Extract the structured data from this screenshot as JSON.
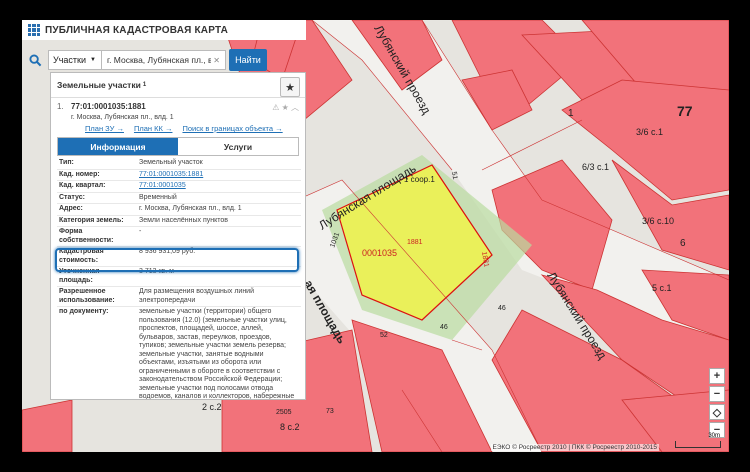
{
  "header": {
    "title": "ПУБЛИЧНАЯ КАДАСТРОВАЯ КАРТА"
  },
  "search": {
    "type_label": "Участки",
    "query": "г. Москва, Лубянская пл., влд. 1",
    "button": "Найти"
  },
  "panel": {
    "title": "Земельные участки",
    "count": "1",
    "item_number": "1.",
    "cadastral_number": "77:01:0001035:1881",
    "address": "г. Москва, Лубянская пл., влд. 1",
    "links": [
      "План ЗУ →",
      "План КК →",
      "Поиск в границах объекта →"
    ],
    "tabs": [
      "Информация",
      "Услуги"
    ],
    "fields": [
      {
        "k": "Тип:",
        "v": "Земельный участок"
      },
      {
        "k": "Кад. номер:",
        "v": "77:01:0001035:1881",
        "link": true
      },
      {
        "k": "Кад. квартал:",
        "v": "77:01:0001035",
        "link": true
      },
      {
        "k": "Статус:",
        "v": "Временный"
      },
      {
        "k": "Адрес:",
        "v": "г. Москва, Лубянская пл., влд. 1"
      },
      {
        "k": "Категория земель:",
        "v": "Земли населённых пунктов"
      },
      {
        "k": "Форма собственности:",
        "v": "-"
      },
      {
        "k": "Кадастровая стоимость:",
        "v": "8 936 931,09 руб."
      },
      {
        "k": "Уточненная площадь:",
        "v": "3 713 кв. м"
      },
      {
        "k": "Разрешенное использование:",
        "v": "Для размещения воздушных линий электропередачи"
      },
      {
        "k": "по документу:",
        "v": "земельные участки (территории) общего пользования (12.0) (земельные участки улиц, проспектов, площадей, шоссе, аллей, бульваров, застав, переулков, проездов, тупиков; земельные участки земель резерва; земельные участки, занятые водными объектами, изъятыми из оборота или ограниченными в обороте в соответствии с законодательством Российской Федерации; земельные участки под полосами отвода водоемов, каналов и коллекторов, набережные"
      }
    ]
  },
  "map": {
    "labels": {
      "street1": "Лубянская площадь",
      "street2": "Лубянский проезд",
      "street3": "Лубянский проезд",
      "street4": "ая площадь",
      "street5": "ский",
      "parcel": "0001035",
      "n1881": "1881",
      "n1881b": "1881",
      "n1031": "1031",
      "b1": "1 соор.1",
      "b77": "77",
      "b1a": "1",
      "b36": "3/6 с.1",
      "b63": "6/3 с.1",
      "b36b": "3/6 с.10",
      "b6": "6",
      "b5": "5 с.1",
      "b2": "2 с.2",
      "b8": "8 с.2",
      "b46": "46",
      "b46b": "46",
      "b52": "52",
      "b2505": "2505",
      "b73": "73",
      "b51": "51"
    },
    "attribution": "ЕЭКО © Росреестр 2010 | ПКК © Росреестр 2010-2015",
    "scale": "30m"
  },
  "zoom": {
    "in": "+",
    "out": "−",
    "home": "◇",
    "minus": "−"
  }
}
